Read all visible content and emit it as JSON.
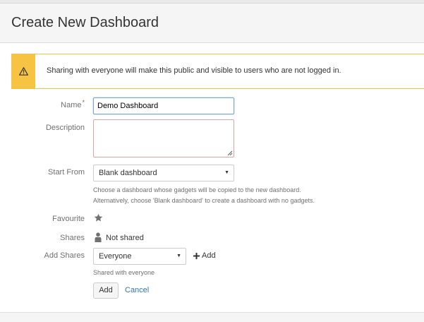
{
  "dialog": {
    "title": "Create New Dashboard"
  },
  "warning": {
    "icon": "warning-icon",
    "text": "Sharing with everyone will make this public and visible to users who are not logged in."
  },
  "form": {
    "name": {
      "label": "Name",
      "required_marker": "*",
      "value": "Demo Dashboard"
    },
    "description": {
      "label": "Description",
      "value": ""
    },
    "start_from": {
      "label": "Start From",
      "selected": "Blank dashboard",
      "help_line1": "Choose a dashboard whose gadgets will be copied to the new dashboard.",
      "help_line2": "Alternatively, choose 'Blank dashboard' to create a dashboard with no gadgets."
    },
    "favourite": {
      "label": "Favourite",
      "icon": "star-icon"
    },
    "shares": {
      "label": "Shares",
      "icon": "person-icon",
      "value": "Not shared"
    },
    "add_shares": {
      "label": "Add Shares",
      "selected": "Everyone",
      "add_label": "Add",
      "help": "Shared with everyone"
    },
    "buttons": {
      "add": "Add",
      "cancel": "Cancel"
    }
  },
  "colors": {
    "warning_accent": "#f6c342",
    "link": "#3572b0",
    "required": "#d04437"
  }
}
